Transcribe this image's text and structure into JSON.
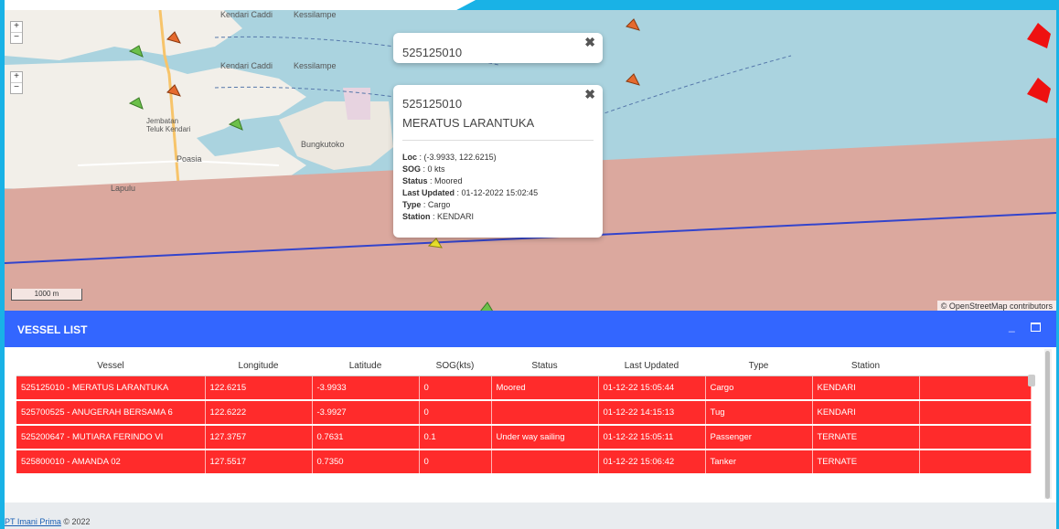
{
  "map": {
    "zoom_in": "+",
    "zoom_out": "−",
    "town_labels": [
      "Kendari Caddi",
      "Kessilampe",
      "Jembatan Teluk Kendari",
      "Bungkutoko",
      "Poasia",
      "Lapulu"
    ],
    "scale_label": "1000 m",
    "attribution": "© OpenStreetMap contributors",
    "colors": {
      "water": "#aad3df",
      "land": "#f2efe9",
      "zone": "#dba89e",
      "route": "#3344cc"
    }
  },
  "popup_small": {
    "title": "525125010",
    "close": "✖"
  },
  "popup_main": {
    "mmsi": "525125010",
    "name": "MERATUS LARANTUKA",
    "close": "✖",
    "fields": [
      {
        "label": "Loc",
        "value": "(-3.9933, 122.6215)"
      },
      {
        "label": "SOG",
        "value": "0 kts"
      },
      {
        "label": "Status",
        "value": "Moored"
      },
      {
        "label": "Last Updated",
        "value": "01-12-2022 15:02:45"
      },
      {
        "label": "Type",
        "value": "Cargo"
      },
      {
        "label": "Station",
        "value": "KENDARI"
      }
    ]
  },
  "panel": {
    "title": "VESSEL LIST",
    "minimize": "_"
  },
  "table": {
    "headers": [
      "Vessel",
      "Longitude",
      "Latitude",
      "SOG(kts)",
      "Status",
      "Last Updated",
      "Type",
      "Station",
      ""
    ],
    "rows": [
      [
        "525125010 - MERATUS LARANTUKA",
        "122.6215",
        "-3.9933",
        "0",
        "Moored",
        "01-12-22 15:05:44",
        "Cargo",
        "KENDARI",
        ""
      ],
      [
        "525700525 - ANUGERAH BERSAMA 6",
        "122.6222",
        "-3.9927",
        "0",
        "",
        "01-12-22 14:15:13",
        "Tug",
        "KENDARI",
        ""
      ],
      [
        "525200647 - MUTIARA FERINDO VI",
        "127.3757",
        "0.7631",
        "0.1",
        "Under way sailing",
        "01-12-22 15:05:11",
        "Passenger",
        "TERNATE",
        ""
      ],
      [
        "525800010 - AMANDA 02",
        "127.5517",
        "0.7350",
        "0",
        "",
        "01-12-22 15:06:42",
        "Tanker",
        "TERNATE",
        ""
      ]
    ],
    "row_color": "#ff2b2b"
  },
  "footer": {
    "link": "PT Imani Prima",
    "copy": "© 2022"
  }
}
